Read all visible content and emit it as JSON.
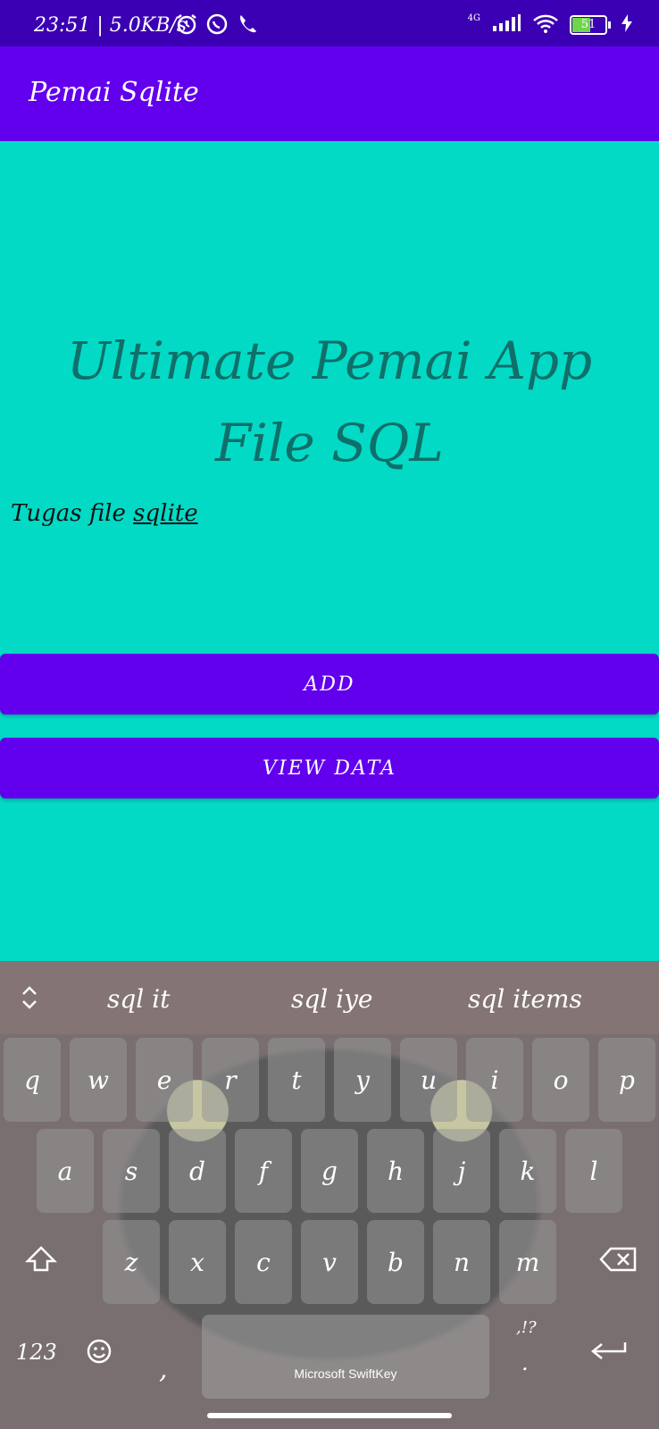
{
  "status_bar": {
    "time": "23:51 | 5.0KB/s",
    "network": "4G",
    "battery": "51"
  },
  "app_bar": {
    "title": "Pemai Sqlite"
  },
  "main": {
    "headline_line1": "Ultimate Pemai App",
    "headline_line2": "File SQL",
    "subtitle_prefix": "Tugas file",
    "subtitle_link": "sqlite",
    "add_button": "ADD",
    "view_button": "VIEW DATA"
  },
  "keyboard": {
    "suggestions": [
      "sql it",
      "sql iye",
      "sql items"
    ],
    "row1": [
      "q",
      "w",
      "e",
      "r",
      "t",
      "y",
      "u",
      "i",
      "o",
      "p"
    ],
    "row2": [
      "a",
      "s",
      "d",
      "f",
      "g",
      "h",
      "j",
      "k",
      "l"
    ],
    "row3": [
      "z",
      "x",
      "c",
      "v",
      "b",
      "n",
      "m"
    ],
    "numbers_key": "123",
    "comma_key": ",",
    "period_key": ".",
    "punct_hint": ",!?",
    "space_label": "Microsoft SwiftKey"
  },
  "colors": {
    "status_bar": "#3b00b3",
    "app_bar": "#6200ee",
    "content_bg": "#02dac6",
    "button": "#6200ee",
    "headline": "#0f6f69"
  }
}
